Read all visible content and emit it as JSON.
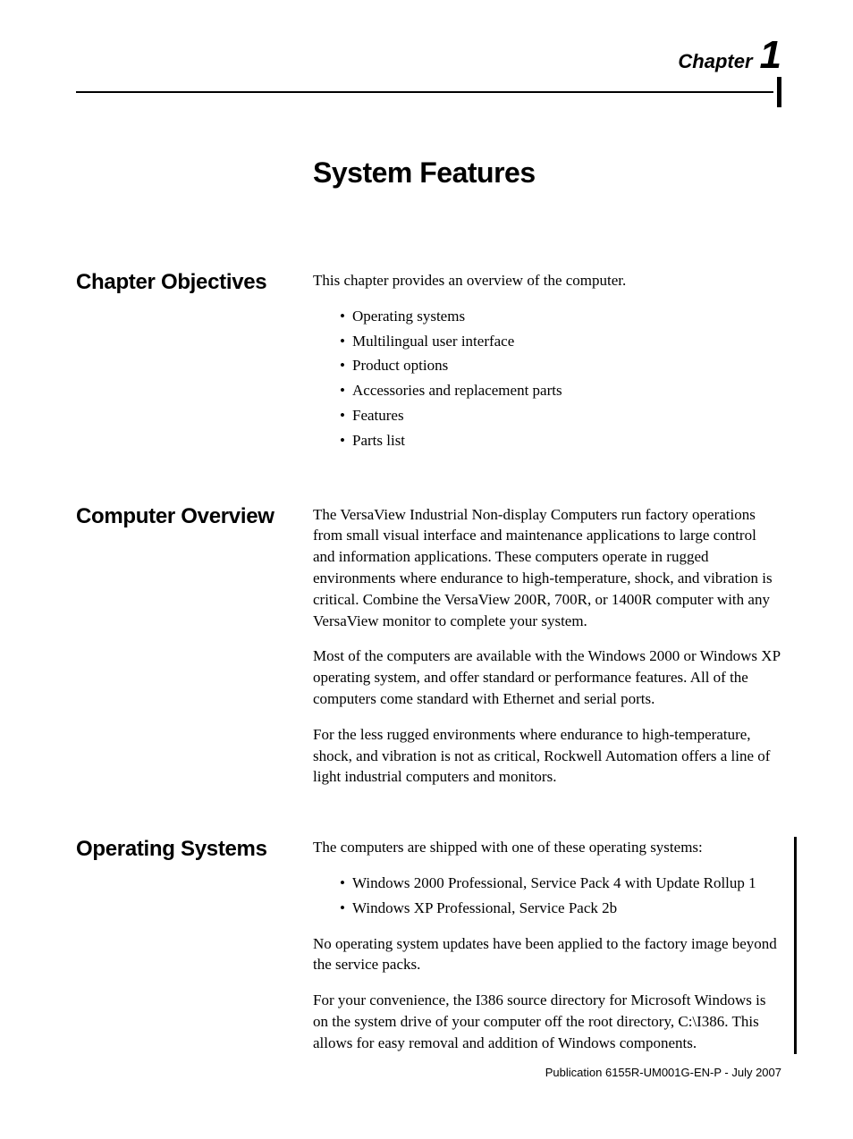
{
  "chapter": {
    "word": "Chapter",
    "number": "1"
  },
  "title": "System Features",
  "sections": {
    "objectives": {
      "heading": "Chapter Objectives",
      "intro": "This chapter provides an overview of the computer.",
      "bullets": [
        "Operating systems",
        "Multilingual user interface",
        "Product options",
        "Accessories and replacement parts",
        "Features",
        "Parts list"
      ]
    },
    "overview": {
      "heading": "Computer Overview",
      "p1": "The VersaView Industrial Non-display Computers run factory operations from small visual interface and maintenance applications to large control and information applications. These computers operate in rugged environments where endurance to high-temperature, shock, and vibration is critical. Combine the VersaView 200R, 700R, or 1400R computer with any VersaView monitor to complete your system.",
      "p2": "Most of the computers are available with the Windows 2000 or Windows XP operating system, and offer standard or performance features. All of the computers come standard with Ethernet and serial ports.",
      "p3": "For the less rugged environments where endurance to high-temperature, shock, and vibration is not as critical, Rockwell Automation offers a line of light industrial computers and monitors."
    },
    "os": {
      "heading": "Operating Systems",
      "intro": "The computers are shipped with one of these operating systems:",
      "bullets": [
        "Windows 2000 Professional, Service Pack 4 with Update Rollup 1",
        "Windows XP Professional, Service Pack 2b"
      ],
      "p2": "No operating system updates have been applied to the factory image beyond the service packs.",
      "p3": "For your convenience, the I386 source directory for Microsoft Windows is on the system drive of your computer off the root directory, C:\\I386. This allows for easy removal and addition of Windows components."
    }
  },
  "footer": "Publication 6155R-UM001G-EN-P - July 2007"
}
